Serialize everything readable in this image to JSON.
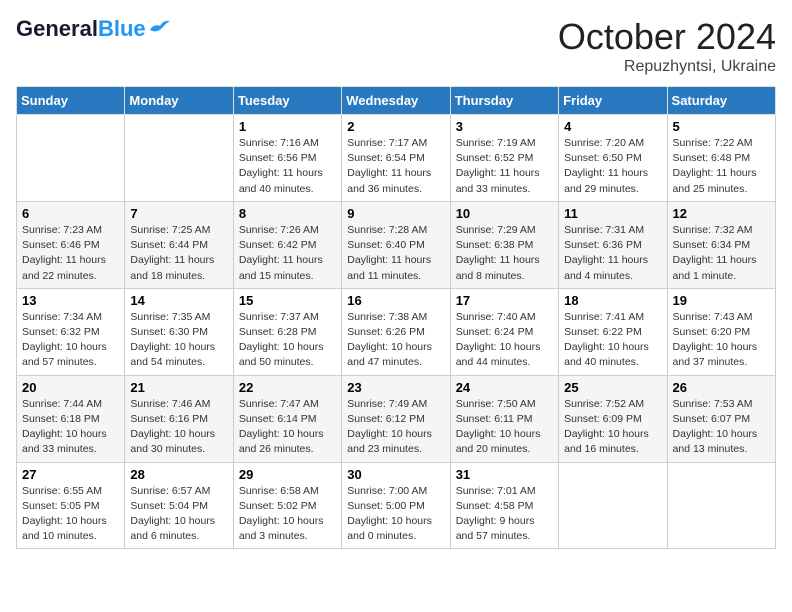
{
  "header": {
    "logo_general": "General",
    "logo_blue": "Blue",
    "month_title": "October 2024",
    "subtitle": "Repuzhyntsi, Ukraine"
  },
  "weekdays": [
    "Sunday",
    "Monday",
    "Tuesday",
    "Wednesday",
    "Thursday",
    "Friday",
    "Saturday"
  ],
  "weeks": [
    [
      {
        "day": "",
        "sunrise": "",
        "sunset": "",
        "daylight": ""
      },
      {
        "day": "",
        "sunrise": "",
        "sunset": "",
        "daylight": ""
      },
      {
        "day": "1",
        "sunrise": "Sunrise: 7:16 AM",
        "sunset": "Sunset: 6:56 PM",
        "daylight": "Daylight: 11 hours and 40 minutes."
      },
      {
        "day": "2",
        "sunrise": "Sunrise: 7:17 AM",
        "sunset": "Sunset: 6:54 PM",
        "daylight": "Daylight: 11 hours and 36 minutes."
      },
      {
        "day": "3",
        "sunrise": "Sunrise: 7:19 AM",
        "sunset": "Sunset: 6:52 PM",
        "daylight": "Daylight: 11 hours and 33 minutes."
      },
      {
        "day": "4",
        "sunrise": "Sunrise: 7:20 AM",
        "sunset": "Sunset: 6:50 PM",
        "daylight": "Daylight: 11 hours and 29 minutes."
      },
      {
        "day": "5",
        "sunrise": "Sunrise: 7:22 AM",
        "sunset": "Sunset: 6:48 PM",
        "daylight": "Daylight: 11 hours and 25 minutes."
      }
    ],
    [
      {
        "day": "6",
        "sunrise": "Sunrise: 7:23 AM",
        "sunset": "Sunset: 6:46 PM",
        "daylight": "Daylight: 11 hours and 22 minutes."
      },
      {
        "day": "7",
        "sunrise": "Sunrise: 7:25 AM",
        "sunset": "Sunset: 6:44 PM",
        "daylight": "Daylight: 11 hours and 18 minutes."
      },
      {
        "day": "8",
        "sunrise": "Sunrise: 7:26 AM",
        "sunset": "Sunset: 6:42 PM",
        "daylight": "Daylight: 11 hours and 15 minutes."
      },
      {
        "day": "9",
        "sunrise": "Sunrise: 7:28 AM",
        "sunset": "Sunset: 6:40 PM",
        "daylight": "Daylight: 11 hours and 11 minutes."
      },
      {
        "day": "10",
        "sunrise": "Sunrise: 7:29 AM",
        "sunset": "Sunset: 6:38 PM",
        "daylight": "Daylight: 11 hours and 8 minutes."
      },
      {
        "day": "11",
        "sunrise": "Sunrise: 7:31 AM",
        "sunset": "Sunset: 6:36 PM",
        "daylight": "Daylight: 11 hours and 4 minutes."
      },
      {
        "day": "12",
        "sunrise": "Sunrise: 7:32 AM",
        "sunset": "Sunset: 6:34 PM",
        "daylight": "Daylight: 11 hours and 1 minute."
      }
    ],
    [
      {
        "day": "13",
        "sunrise": "Sunrise: 7:34 AM",
        "sunset": "Sunset: 6:32 PM",
        "daylight": "Daylight: 10 hours and 57 minutes."
      },
      {
        "day": "14",
        "sunrise": "Sunrise: 7:35 AM",
        "sunset": "Sunset: 6:30 PM",
        "daylight": "Daylight: 10 hours and 54 minutes."
      },
      {
        "day": "15",
        "sunrise": "Sunrise: 7:37 AM",
        "sunset": "Sunset: 6:28 PM",
        "daylight": "Daylight: 10 hours and 50 minutes."
      },
      {
        "day": "16",
        "sunrise": "Sunrise: 7:38 AM",
        "sunset": "Sunset: 6:26 PM",
        "daylight": "Daylight: 10 hours and 47 minutes."
      },
      {
        "day": "17",
        "sunrise": "Sunrise: 7:40 AM",
        "sunset": "Sunset: 6:24 PM",
        "daylight": "Daylight: 10 hours and 44 minutes."
      },
      {
        "day": "18",
        "sunrise": "Sunrise: 7:41 AM",
        "sunset": "Sunset: 6:22 PM",
        "daylight": "Daylight: 10 hours and 40 minutes."
      },
      {
        "day": "19",
        "sunrise": "Sunrise: 7:43 AM",
        "sunset": "Sunset: 6:20 PM",
        "daylight": "Daylight: 10 hours and 37 minutes."
      }
    ],
    [
      {
        "day": "20",
        "sunrise": "Sunrise: 7:44 AM",
        "sunset": "Sunset: 6:18 PM",
        "daylight": "Daylight: 10 hours and 33 minutes."
      },
      {
        "day": "21",
        "sunrise": "Sunrise: 7:46 AM",
        "sunset": "Sunset: 6:16 PM",
        "daylight": "Daylight: 10 hours and 30 minutes."
      },
      {
        "day": "22",
        "sunrise": "Sunrise: 7:47 AM",
        "sunset": "Sunset: 6:14 PM",
        "daylight": "Daylight: 10 hours and 26 minutes."
      },
      {
        "day": "23",
        "sunrise": "Sunrise: 7:49 AM",
        "sunset": "Sunset: 6:12 PM",
        "daylight": "Daylight: 10 hours and 23 minutes."
      },
      {
        "day": "24",
        "sunrise": "Sunrise: 7:50 AM",
        "sunset": "Sunset: 6:11 PM",
        "daylight": "Daylight: 10 hours and 20 minutes."
      },
      {
        "day": "25",
        "sunrise": "Sunrise: 7:52 AM",
        "sunset": "Sunset: 6:09 PM",
        "daylight": "Daylight: 10 hours and 16 minutes."
      },
      {
        "day": "26",
        "sunrise": "Sunrise: 7:53 AM",
        "sunset": "Sunset: 6:07 PM",
        "daylight": "Daylight: 10 hours and 13 minutes."
      }
    ],
    [
      {
        "day": "27",
        "sunrise": "Sunrise: 6:55 AM",
        "sunset": "Sunset: 5:05 PM",
        "daylight": "Daylight: 10 hours and 10 minutes."
      },
      {
        "day": "28",
        "sunrise": "Sunrise: 6:57 AM",
        "sunset": "Sunset: 5:04 PM",
        "daylight": "Daylight: 10 hours and 6 minutes."
      },
      {
        "day": "29",
        "sunrise": "Sunrise: 6:58 AM",
        "sunset": "Sunset: 5:02 PM",
        "daylight": "Daylight: 10 hours and 3 minutes."
      },
      {
        "day": "30",
        "sunrise": "Sunrise: 7:00 AM",
        "sunset": "Sunset: 5:00 PM",
        "daylight": "Daylight: 10 hours and 0 minutes."
      },
      {
        "day": "31",
        "sunrise": "Sunrise: 7:01 AM",
        "sunset": "Sunset: 4:58 PM",
        "daylight": "Daylight: 9 hours and 57 minutes."
      },
      {
        "day": "",
        "sunrise": "",
        "sunset": "",
        "daylight": ""
      },
      {
        "day": "",
        "sunrise": "",
        "sunset": "",
        "daylight": ""
      }
    ]
  ]
}
